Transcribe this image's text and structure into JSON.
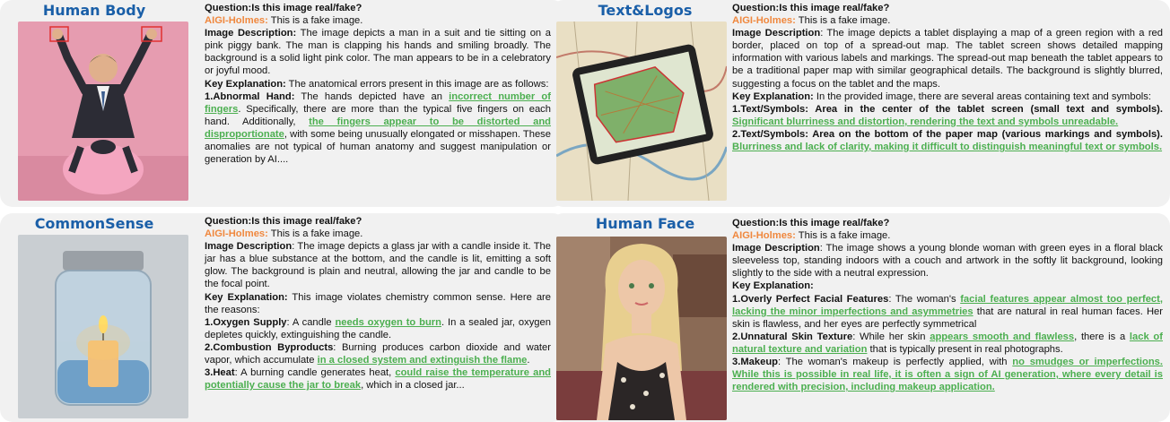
{
  "panels": [
    {
      "category": "Human Body",
      "question": "Question:Is this image real/fake?",
      "holmes_label": "AIGI-Holmes:",
      "holmes_text": " This is a fake image.",
      "desc_label": "Image Description:",
      "desc_text": " The image depicts a man in a suit and tie sitting on a pink piggy bank. The man is clapping his hands and smiling broadly. The background is a solid light pink color. The man appears to be in a celebratory or joyful mood.",
      "key_label": "Key Explanation:",
      "key_text": " The anatomical errors present in this image are as follows:",
      "item1_label": "1.Abnormal Hand:",
      "item1_pre": " The hands depicted have an ",
      "item1_hl1": "incorrect number of fingers",
      "item1_mid": ". Specifically, there are more than the typical five fingers on each hand. Additionally, ",
      "item1_hl2": "the fingers appear to be distorted and disproportionate",
      "item1_post": ", with some being unusually elongated or misshapen. These anomalies are not typical of human anatomy and suggest manipulation or generation by AI...."
    },
    {
      "category": "Text&Logos",
      "question": "Question:Is this image real/fake?",
      "holmes_label": "AIGI-Holmes:",
      "holmes_text": " This is a fake image.",
      "desc_label": "Image Description",
      "desc_text": ": The image depicts a tablet displaying a map of a green region with a red border, placed on top of a spread-out map. The tablet screen shows detailed mapping information with various labels and markings. The spread-out map beneath the tablet appears to be a traditional paper map with similar geographical details. The background is slightly blurred, suggesting a focus on the tablet and the maps.",
      "key_label": "Key Explanation:",
      "key_text": " In the provided image, there are several areas containing text and symbols:",
      "item1_label": "1.Text/Symbols: Area in the center of the tablet screen (small text and symbols).",
      "item1_hl": "Significant blurriness and distortion, rendering the text and symbols unreadable.",
      "item2_label": "2.Text/Symbols: Area on the bottom of the paper map (various markings and symbols).",
      "item2_hl": "Blurriness and lack of clarity, making it difficult to distinguish meaningful text or symbols."
    },
    {
      "category": "CommonSense",
      "question": "Question:Is this image real/fake?",
      "holmes_label": "AIGI-Holmes:",
      "holmes_text": " This is a fake image.",
      "desc_label": "Image Description",
      "desc_text": ": The image depicts a glass jar with a candle inside it. The jar has a blue substance at the bottom, and the candle is lit, emitting a soft glow. The background is plain and neutral, allowing the jar and candle to be the focal point.",
      "key_label": "Key Explanation:",
      "key_text": " This image violates chemistry common sense. Here are the reasons:",
      "item1_label": "1.Oxygen Supply",
      "item1_pre": ": A candle ",
      "item1_hl": "needs oxygen to burn",
      "item1_post": ". In a sealed jar, oxygen depletes quickly, extinguishing the candle.",
      "item2_label": "2.Combustion Byproducts",
      "item2_pre": ": Burning produces carbon dioxide and water vapor, which accumulate ",
      "item2_hl": "in a closed system and extinguish the flame",
      "item2_post": ".",
      "item3_label": "3.Heat",
      "item3_pre": ": A burning candle generates heat, ",
      "item3_hl": "could raise the temperature and potentially cause the jar to break",
      "item3_post": ", which in a closed jar..."
    },
    {
      "category": "Human Face",
      "question": "Question:Is this image real/fake?",
      "holmes_label": "AIGI-Holmes:",
      "holmes_text": " This is a fake image.",
      "desc_label": "Image Description",
      "desc_text": ": The image shows a young blonde woman with green eyes in a floral black sleeveless top, standing indoors with a couch and artwork in the softly lit background, looking slightly to the side with a neutral expression.",
      "key_label": "Key Explanation:",
      "item1_label": "1.Overly Perfect Facial Features",
      "item1_pre": ": The woman's ",
      "item1_hl": "facial features appear almost too perfect, lacking the minor imperfections and asymmetries",
      "item1_post": " that are natural in real human faces. Her skin is flawless, and her eyes are perfectly symmetrical",
      "item2_label": "2.Unnatural Skin Texture",
      "item2_pre": ": While her skin ",
      "item2_hl1": "appears smooth and flawless",
      "item2_mid": ", there is a ",
      "item2_hl2": "lack of natural texture and variation",
      "item2_post": " that is typically present in real photographs.",
      "item3_label": "3.Makeup",
      "item3_pre": ": The woman's makeup is perfectly applied, with ",
      "item3_hl": "no smudges or imperfections. While this is possible in real life, it is often a sign of AI generation, where every detail is rendered with precision, including makeup application."
    }
  ]
}
